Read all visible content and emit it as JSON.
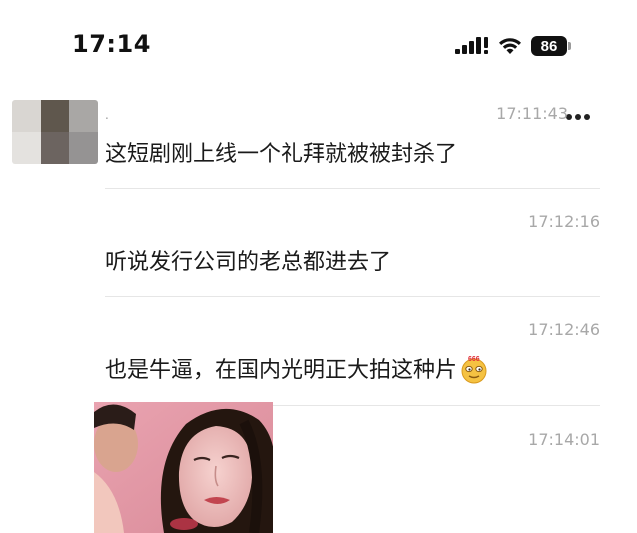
{
  "status_bar": {
    "time": "17:14",
    "battery": "86",
    "icons": [
      "signal-icon",
      "wifi-icon",
      "battery-icon"
    ]
  },
  "sender": {
    "name": ".",
    "avatar": "pixelated-avatar"
  },
  "messages": [
    {
      "time": "17:11:43",
      "text": "这短剧刚上线一个礼拜就被被封杀了"
    },
    {
      "time": "17:12:16",
      "text": "听说发行公司的老总都进去了"
    },
    {
      "time": "17:12:46",
      "text": "也是牛逼，在国内光明正大拍这种片",
      "emoji": "666-emoji"
    },
    {
      "time": "17:14:01",
      "image": "photo-thumbnail"
    }
  ],
  "colors": {
    "time_gray": "#a8a8a8",
    "text": "#1a1a1a",
    "divider": "#e6e6e6"
  }
}
